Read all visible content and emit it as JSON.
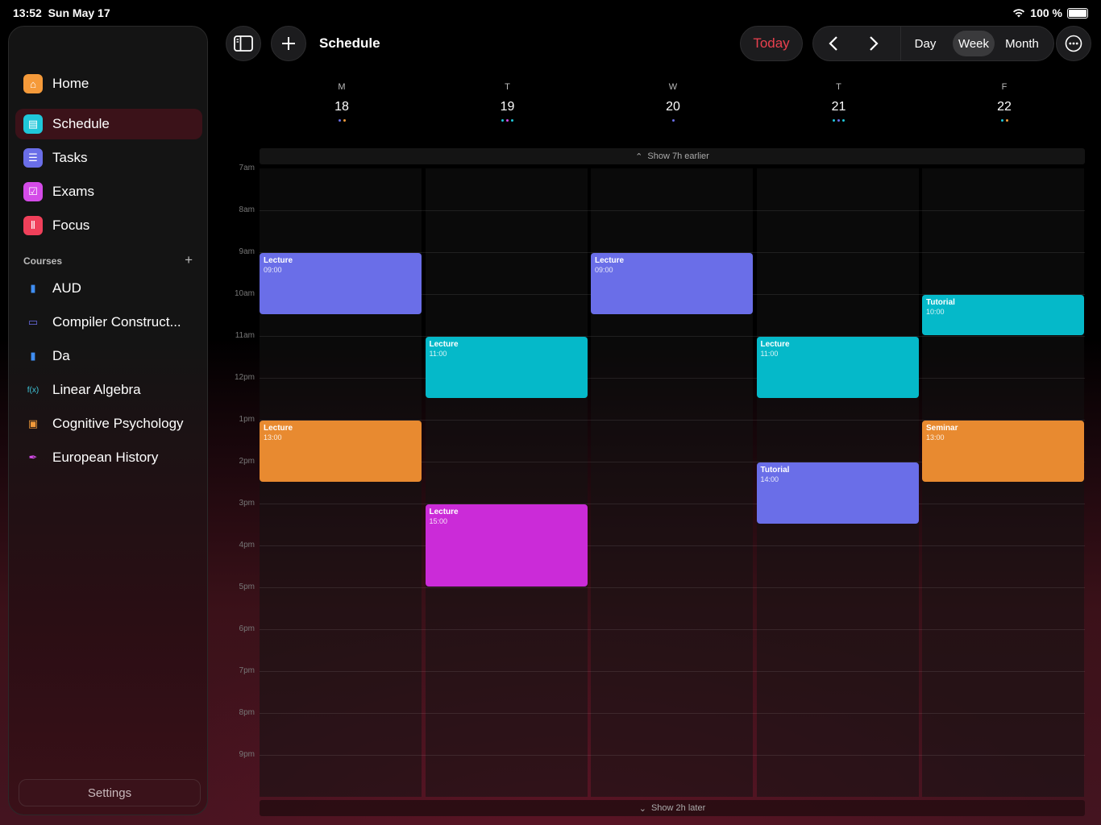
{
  "status": {
    "time": "13:52",
    "date": "Sun May 17",
    "battery": "100 %"
  },
  "sidebar": {
    "nav": [
      {
        "label": "Home",
        "icon": "home-icon",
        "color": "#f59a3a",
        "active": false
      },
      {
        "label": "Schedule",
        "icon": "calendar-icon",
        "color": "#1fc7d9",
        "active": true
      },
      {
        "label": "Tasks",
        "icon": "tasks-icon",
        "color": "#6a6ee8",
        "active": false
      },
      {
        "label": "Exams",
        "icon": "clipboard-icon",
        "color": "#d44be8",
        "active": false
      },
      {
        "label": "Focus",
        "icon": "focus-icon",
        "color": "#f0405a",
        "active": false
      }
    ],
    "courses_header": "Courses",
    "courses": [
      {
        "label": "AUD",
        "icon": "book-icon",
        "color": "#3f8ef2"
      },
      {
        "label": "Compiler Construct...",
        "icon": "laptop-icon",
        "color": "#6b6ee8"
      },
      {
        "label": "Da",
        "icon": "book-icon",
        "color": "#3f8ef2"
      },
      {
        "label": "Linear Algebra",
        "icon": "function-icon",
        "color": "#3fc6d9"
      },
      {
        "label": "Cognitive Psychology",
        "icon": "briefcase-icon",
        "color": "#f29a3a"
      },
      {
        "label": "European History",
        "icon": "scroll-icon",
        "color": "#d44be8"
      }
    ],
    "settings_label": "Settings"
  },
  "toolbar": {
    "title": "Schedule",
    "today_label": "Today",
    "view_options": [
      "Day",
      "Week",
      "Month"
    ],
    "selected_view": "Week"
  },
  "calendar": {
    "days": [
      {
        "letter": "M",
        "number": "18",
        "dots": [
          "#6a6ee8",
          "#f29a3a"
        ]
      },
      {
        "letter": "T",
        "number": "19",
        "dots": [
          "#1fc7d9",
          "#d44be8",
          "#1fc7d9"
        ]
      },
      {
        "letter": "W",
        "number": "20",
        "dots": [
          "#6a6ee8"
        ]
      },
      {
        "letter": "T",
        "number": "21",
        "dots": [
          "#1fc7d9",
          "#6a6ee8",
          "#1fc7d9"
        ]
      },
      {
        "letter": "F",
        "number": "22",
        "dots": [
          "#1fc7d9",
          "#f29a3a"
        ]
      }
    ],
    "show_earlier": "Show 7h earlier",
    "show_later": "Show 2h later",
    "time_labels": [
      "7am",
      "8am",
      "9am",
      "10am",
      "11am",
      "12pm",
      "1pm",
      "2pm",
      "3pm",
      "4pm",
      "5pm",
      "6pm",
      "7pm",
      "8pm",
      "9pm"
    ],
    "events": [
      {
        "day": 0,
        "title": "Lecture",
        "time": "09:00",
        "start": 9,
        "end": 10.5,
        "color": "#6a6ee8"
      },
      {
        "day": 0,
        "title": "Lecture",
        "time": "13:00",
        "start": 13,
        "end": 14.5,
        "color": "#e88a30"
      },
      {
        "day": 1,
        "title": "Lecture",
        "time": "11:00",
        "start": 11,
        "end": 12.5,
        "color": "#05b9c9"
      },
      {
        "day": 1,
        "title": "Lecture",
        "time": "15:00",
        "start": 15,
        "end": 17,
        "color": "#cb2bd8"
      },
      {
        "day": 2,
        "title": "Lecture",
        "time": "09:00",
        "start": 9,
        "end": 10.5,
        "color": "#6a6ee8"
      },
      {
        "day": 3,
        "title": "Lecture",
        "time": "11:00",
        "start": 11,
        "end": 12.5,
        "color": "#05b9c9"
      },
      {
        "day": 3,
        "title": "Tutorial",
        "time": "14:00",
        "start": 14,
        "end": 15.5,
        "color": "#6a6ee8"
      },
      {
        "day": 4,
        "title": "Tutorial",
        "time": "10:00",
        "start": 10,
        "end": 11,
        "color": "#05b9c9"
      },
      {
        "day": 4,
        "title": "Seminar",
        "time": "13:00",
        "start": 13,
        "end": 14.5,
        "color": "#e88a30"
      }
    ]
  }
}
